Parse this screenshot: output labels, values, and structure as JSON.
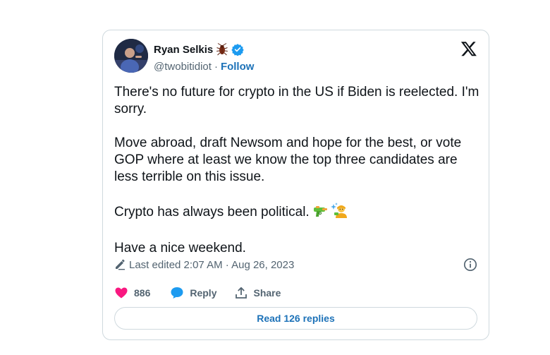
{
  "author": {
    "display_name": "Ryan Selkis",
    "name_emoji": "cockroach-emoji",
    "handle": "@twobitidiot",
    "separator": "·",
    "follow_label": "Follow"
  },
  "tweet": {
    "paragraphs": [
      "There's no future for crypto in the US if Biden is reelected. I'm sorry.",
      "Move abroad, draft Newsom and hope for the best, or vote GOP where at least we know the top three candidates are less terrible on this issue.",
      "Crypto has always been political.",
      "Have a nice weekend."
    ],
    "inline_emojis": [
      "water-pistol-emoji",
      "person-with-sparkles-emoji"
    ]
  },
  "meta": {
    "edited_text": "Last edited 2:07 AM · Aug 26, 2023"
  },
  "actions": {
    "like_count": "886",
    "reply_label": "Reply",
    "share_label": "Share"
  },
  "read_replies_label": "Read 126 replies",
  "colors": {
    "link_blue": "#1d72b8",
    "verified_blue": "#1d9bf0",
    "like_pink": "#f91880",
    "reply_blue": "#1d9bf0",
    "text_primary": "#0f1419",
    "text_secondary": "#536471",
    "border": "#cfd9de"
  }
}
